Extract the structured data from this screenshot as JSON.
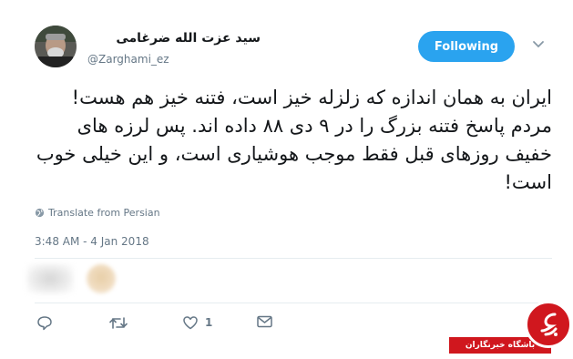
{
  "author": {
    "display_name": "سید عزت الله ضرغامی",
    "handle": "@Zarghami_ez"
  },
  "follow_button": {
    "label": "Following",
    "color": "#2aa3ef"
  },
  "tweet": {
    "text": "ایران به همان اندازه که زلزله خیز است، فتنه خیز هم هست! مردم پاسخ فتنه بزرگ را در ۹ دی ۸۸ داده اند. پس لرزه های خفیف روزهای قبل فقط موجب هوشیاری است، و این خیلی خوب است!",
    "translate_label": "Translate from Persian",
    "timestamp": "3:48 AM - 4 Jan 2018"
  },
  "actions": {
    "reply": {
      "icon": "reply-icon"
    },
    "retweet": {
      "icon": "retweet-icon"
    },
    "like": {
      "icon": "heart-icon",
      "count": "1"
    },
    "message": {
      "icon": "envelope-icon"
    }
  },
  "watermark": {
    "label": "باشگاه خبرنگاران",
    "color": "#d0171e"
  }
}
